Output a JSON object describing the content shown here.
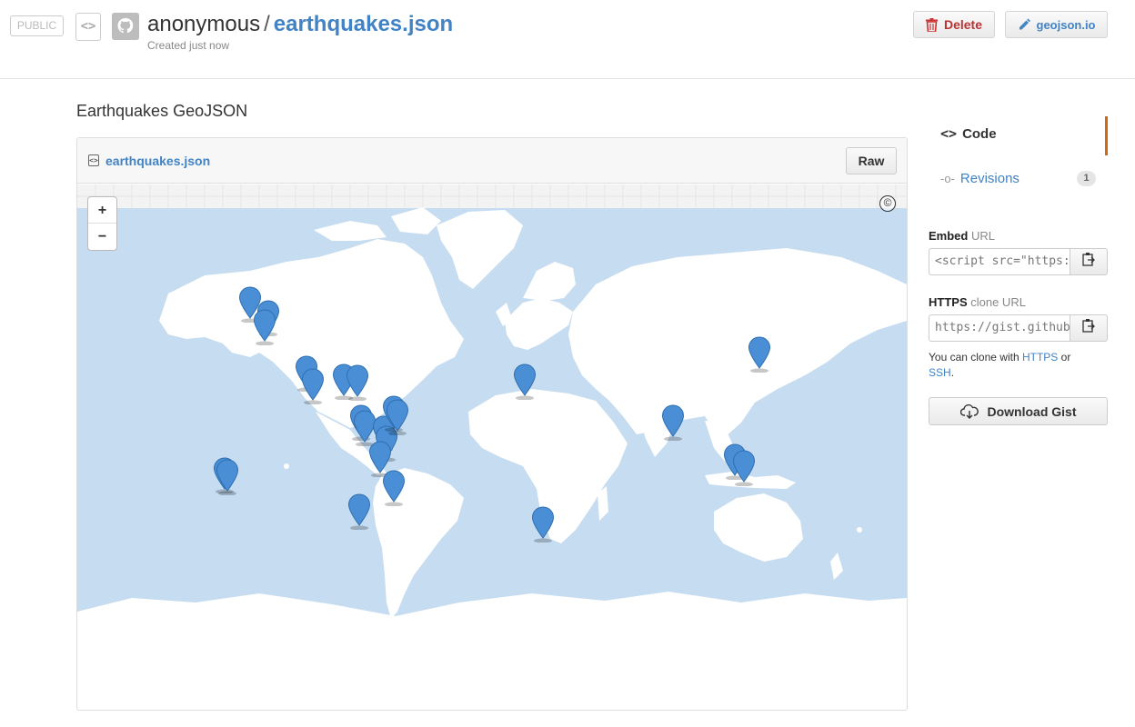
{
  "header": {
    "visibility_badge": "PUBLIC",
    "owner": "anonymous",
    "separator": "/",
    "gist_name": "earthquakes.json",
    "created": "Created just now",
    "delete_label": "Delete",
    "geojson_label": "geojson.io"
  },
  "gist": {
    "description": "Earthquakes GeoJSON",
    "file_name": "earthquakes.json",
    "raw_label": "Raw"
  },
  "map": {
    "zoom_in": "+",
    "zoom_out": "−",
    "attribution": "©",
    "marker_color": "#4a8fd6",
    "water_color": "#c6dcf0",
    "land_color": "#ffffff",
    "marker_count": 30
  },
  "sidebar": {
    "code_label": "Code",
    "revisions_label": "Revisions",
    "revisions_count": "1",
    "embed": {
      "bold": "Embed",
      "rest": " URL",
      "value": "<script src=\"https://gist.github.com/anonymous/"
    },
    "https": {
      "bold": "HTTPS",
      "rest": " clone URL",
      "value": "https://gist.github.com/"
    },
    "clone_note": {
      "prefix": "You can clone with ",
      "https_link": "HTTPS",
      "middle": " or ",
      "ssh_link": "SSH",
      "suffix": "."
    },
    "download_label": "Download Gist"
  },
  "colors": {
    "link": "#4183c4",
    "delete": "#bb3333",
    "active_tab": "#d26911"
  }
}
